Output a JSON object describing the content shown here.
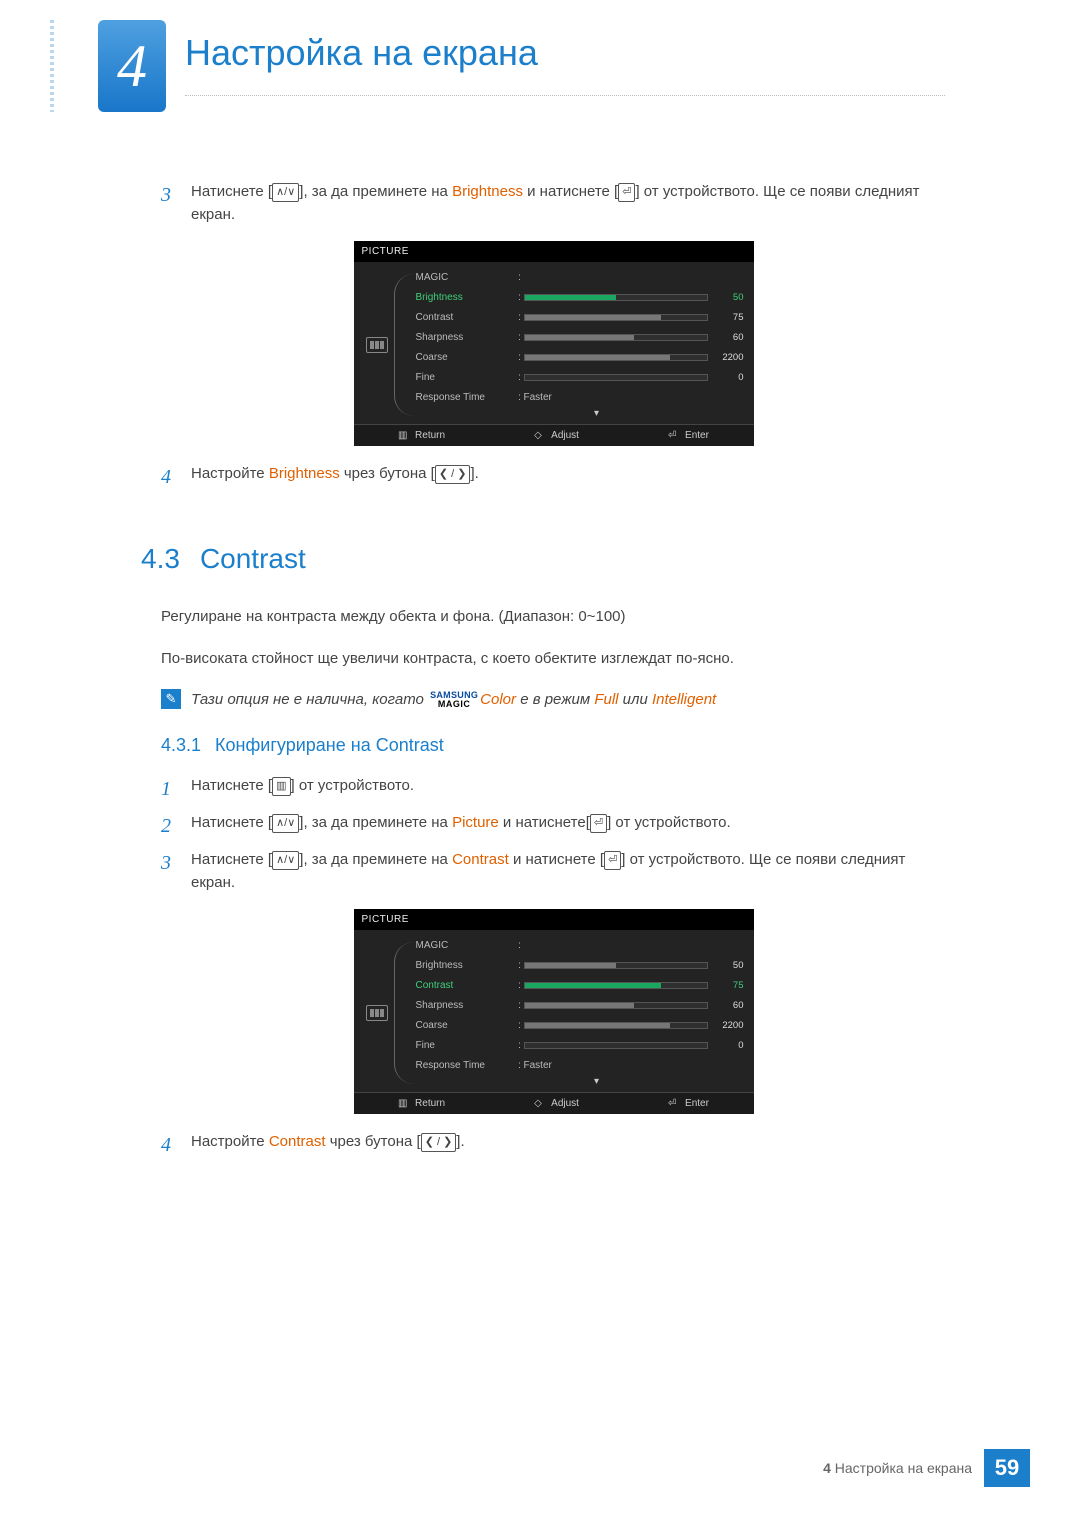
{
  "chapter": {
    "number": "4",
    "title": "Настройка на екрана"
  },
  "step3": {
    "num": "3",
    "t1": "Натиснете [",
    "icon1": "∧/∨",
    "t2": "], за да преминете на ",
    "kw": "Brightness",
    "t3": " и натиснете [",
    "icon2": "⏎",
    "t4": "] от устройството. Ще се появи следният екран."
  },
  "osd1": {
    "title": "PICTURE",
    "rows": {
      "magic": {
        "label": "MAGIC"
      },
      "brightness": {
        "label": "Brightness",
        "value": "50",
        "pct": 50,
        "highlighted": true
      },
      "contrast": {
        "label": "Contrast",
        "value": "75",
        "pct": 75
      },
      "sharpness": {
        "label": "Sharpness",
        "value": "60",
        "pct": 60
      },
      "coarse": {
        "label": "Coarse",
        "value": "2200",
        "pct": 80
      },
      "fine": {
        "label": "Fine",
        "value": "0",
        "pct": 0
      },
      "response": {
        "label": "Response Time",
        "value": "Faster"
      }
    },
    "footer": {
      "return": "Return",
      "adjust": "Adjust",
      "enter": "Enter"
    }
  },
  "step4a": {
    "num": "4",
    "t1": "Настройте ",
    "kw": "Brightness",
    "t2": " чрез бутона [",
    "icon": "❮ / ❯",
    "t3": "]."
  },
  "sec43": {
    "num": "4.3",
    "title": "Contrast"
  },
  "p1": "Регулиране на контраста между обекта и фона. (Диапазон: 0~100)",
  "p2": "По-високата стойност ще увеличи контраста, с което обектите изглеждат по-ясно.",
  "note": {
    "t1": "Тази опция не е налична, когато ",
    "magic_top": "SAMSUNG",
    "magic_bot": "MAGIC",
    "t2": "Color",
    "t3": " е в режим ",
    "kw1": "Full",
    "t4": " или ",
    "kw2": "Intelligent"
  },
  "subsec": {
    "num": "4.3.1",
    "t1": "Конфигуриране на ",
    "kw": "Contrast"
  },
  "bstep1": {
    "num": "1",
    "t1": "Натиснете [",
    "icon": "▥",
    "t2": "] от устройството."
  },
  "bstep2": {
    "num": "2",
    "t1": "Натиснете [",
    "icon1": "∧/∨",
    "t2": "], за да преминете на ",
    "kw": "Picture",
    "t3": " и натиснете[",
    "icon2": "⏎",
    "t4": "] от устройството."
  },
  "bstep3": {
    "num": "3",
    "t1": "Натиснете [",
    "icon1": "∧/∨",
    "t2": "], за да преминете на ",
    "kw": "Contrast",
    "t3": " и натиснете [",
    "icon2": "⏎",
    "t4": "] от устройството. Ще се появи следният екран."
  },
  "osd2": {
    "title": "PICTURE",
    "rows": {
      "magic": {
        "label": "MAGIC"
      },
      "brightness": {
        "label": "Brightness",
        "value": "50",
        "pct": 50
      },
      "contrast": {
        "label": "Contrast",
        "value": "75",
        "pct": 75,
        "highlighted": true
      },
      "sharpness": {
        "label": "Sharpness",
        "value": "60",
        "pct": 60
      },
      "coarse": {
        "label": "Coarse",
        "value": "2200",
        "pct": 80
      },
      "fine": {
        "label": "Fine",
        "value": "0",
        "pct": 0
      },
      "response": {
        "label": "Response Time",
        "value": "Faster"
      }
    },
    "footer": {
      "return": "Return",
      "adjust": "Adjust",
      "enter": "Enter"
    }
  },
  "step4b": {
    "num": "4",
    "t1": "Настройте ",
    "kw": "Contrast",
    "t2": " чрез бутона [",
    "icon": "❮ / ❯",
    "t3": "]."
  },
  "footer": {
    "label_prefix": "4 ",
    "label": "Настройка на екрана",
    "page": "59"
  }
}
